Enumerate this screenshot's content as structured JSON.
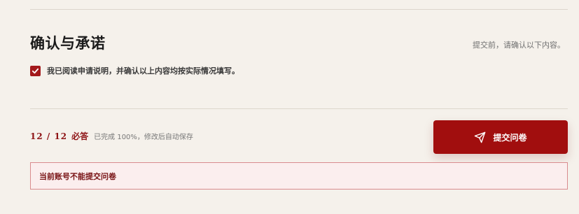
{
  "section": {
    "title": "确认与承诺",
    "hint": "提交前，请确认以下内容。"
  },
  "confirm": {
    "checked": true,
    "label": "我已阅读申请说明，并确认以上内容均按实际情况填写。"
  },
  "progress": {
    "count": "12 / 12",
    "required": "必答",
    "note": "已完成 100%，修改后自动保存",
    "completed_fraction": 1.0
  },
  "submit": {
    "label": "提交问卷",
    "icon": "send-icon"
  },
  "notice": {
    "text": "当前账号不能提交问卷"
  },
  "colors": {
    "background": "#f5f1eb",
    "accent": "#a10e0e",
    "notice_border": "#d98b8e",
    "notice_background": "#fbeeee"
  }
}
